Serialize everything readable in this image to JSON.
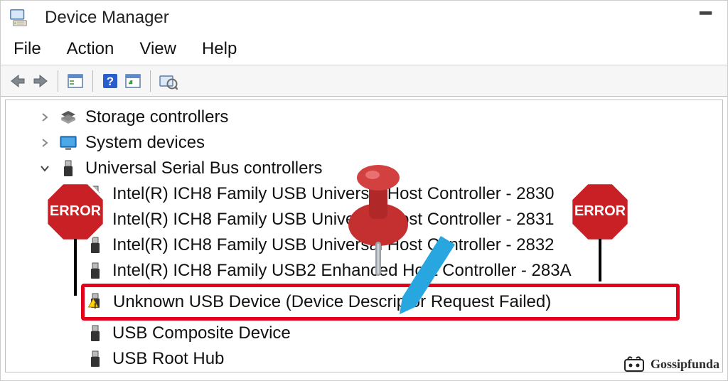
{
  "window": {
    "title": "Device Manager"
  },
  "menu": {
    "file": "File",
    "action": "Action",
    "view": "View",
    "help": "Help"
  },
  "tree": {
    "storage": "Storage controllers",
    "system": "System devices",
    "usb_root": "Universal Serial Bus controllers",
    "usb": {
      "c0": "Intel(R) ICH8 Family USB Universal Host Controller - 2830",
      "c1": "Intel(R) ICH8 Family USB Universal Host Controller - 2831",
      "c2": "Intel(R) ICH8 Family USB Universal Host Controller - 2832",
      "c3": "Intel(R) ICH8 Family USB2 Enhanced Host Controller - 283A",
      "unknown": "Unknown USB Device (Device Descriptor Request Failed)",
      "composite": "USB Composite Device",
      "roothub": "USB Root Hub"
    }
  },
  "badge": {
    "label": "ERROR"
  },
  "watermark": {
    "text": "Gossipfunda"
  },
  "colors": {
    "error_red": "#c92025",
    "highlight": "#e3001b",
    "pin_red": "#c43030",
    "arrow_blue": "#28a6e0"
  }
}
